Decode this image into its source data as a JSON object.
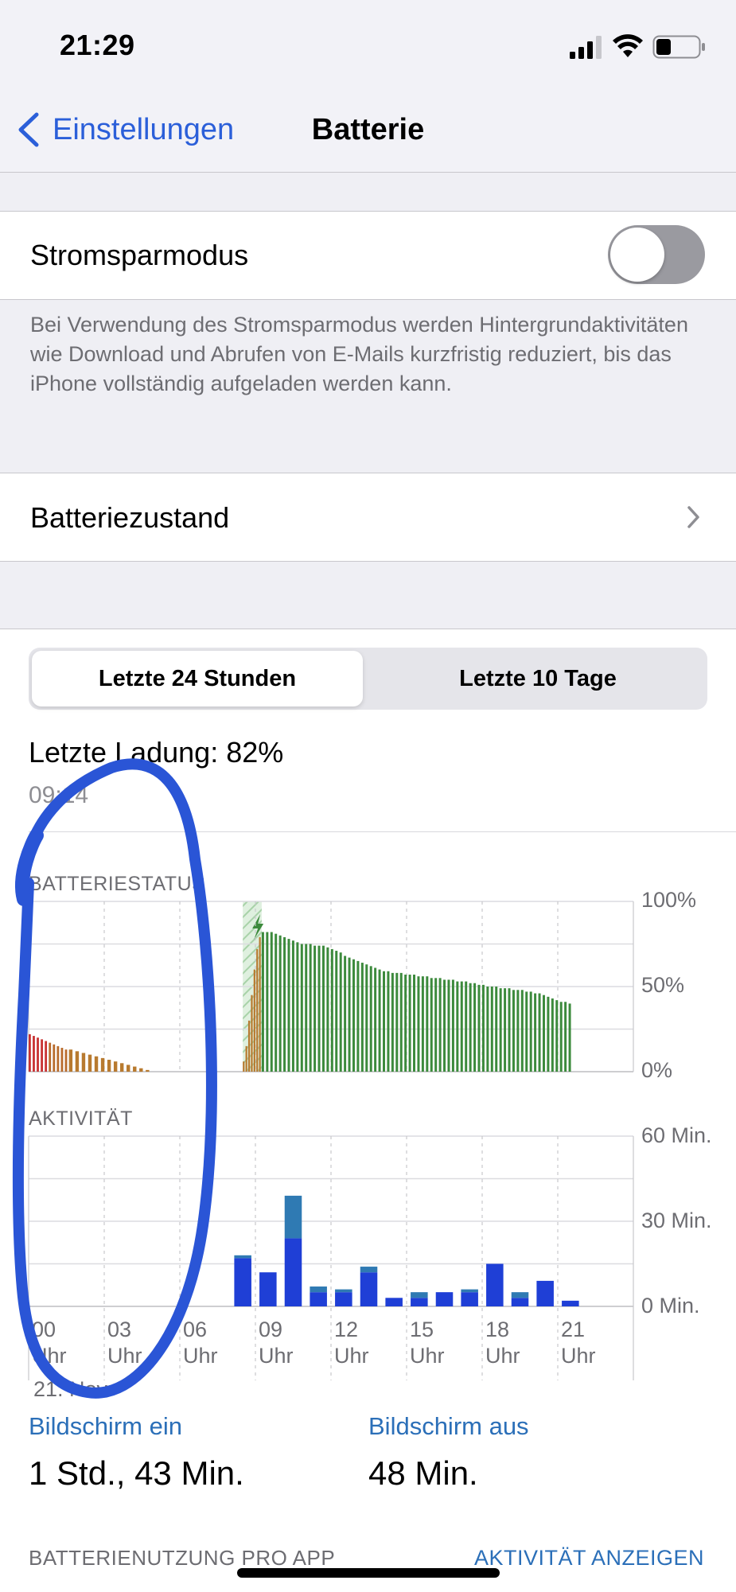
{
  "status": {
    "time": "21:29"
  },
  "nav": {
    "back_label": "Einstellungen",
    "title": "Batterie"
  },
  "low_power": {
    "label": "Stromsparmodus",
    "enabled": false,
    "description": "Bei Verwendung des Stromsparmodus werden Hintergrundaktivitäten wie Download und Abrufen von E-Mails kurzfristig reduziert, bis das iPhone vollständig aufgeladen werden kann."
  },
  "battery_health": {
    "label": "Batteriezustand"
  },
  "segment": {
    "options": [
      "Letzte 24 Stunden",
      "Letzte 10 Tage"
    ],
    "selected": 0
  },
  "last_charge": {
    "label": "Letzte Ladung: 82%",
    "time": "09:14"
  },
  "battery_chart": {
    "heading": "BATTERIESTATUS",
    "y_labels": [
      "100%",
      "50%",
      "0%"
    ]
  },
  "activity_chart": {
    "heading": "AKTIVITÄT",
    "y_labels": [
      "60 Min.",
      "30 Min.",
      "0 Min."
    ],
    "x_ticks": [
      {
        "hour": "00",
        "unit": "Uhr"
      },
      {
        "hour": "03",
        "unit": "Uhr"
      },
      {
        "hour": "06",
        "unit": "Uhr"
      },
      {
        "hour": "09",
        "unit": "Uhr"
      },
      {
        "hour": "12",
        "unit": "Uhr"
      },
      {
        "hour": "15",
        "unit": "Uhr"
      },
      {
        "hour": "18",
        "unit": "Uhr"
      },
      {
        "hour": "21",
        "unit": "Uhr"
      }
    ],
    "date_label": "21. Nov."
  },
  "chart_data": [
    {
      "type": "bar",
      "title": "BATTERIESTATUS",
      "ylabel": "",
      "ylim": [
        0,
        100
      ],
      "x_unit": "hour",
      "charging_window": [
        8.5,
        9.25
      ],
      "segments": [
        {
          "start_hour": 0.0,
          "end_hour": 1.6,
          "values": [
            22,
            21,
            20,
            19,
            18,
            17,
            16,
            15,
            14,
            13
          ],
          "colors": [
            "#c83232",
            "#c83232",
            "#c83232",
            "#c83232",
            "#c83232",
            "#b86a2a",
            "#b86a2a",
            "#b86a2a",
            "#b86a2a",
            "#b86a2a"
          ]
        },
        {
          "start_hour": 1.6,
          "end_hour": 4.9,
          "values": [
            13,
            12,
            11,
            10,
            9,
            8,
            7,
            6,
            5,
            4,
            3,
            2,
            1
          ],
          "color": "#b87a2f"
        },
        {
          "start_hour": 8.5,
          "end_hour": 9.25,
          "values": [
            6,
            15,
            30,
            45,
            60,
            72,
            79
          ],
          "color": "#b87a2f",
          "charging": true
        },
        {
          "start_hour": 9.25,
          "end_hour": 21.6,
          "values": [
            82,
            82,
            82,
            81,
            80,
            79,
            78,
            77,
            76,
            75,
            75,
            75,
            74,
            74,
            74,
            73,
            72,
            71,
            70,
            68,
            67,
            66,
            65,
            64,
            63,
            62,
            61,
            60,
            59,
            59,
            58,
            58,
            58,
            57,
            57,
            57,
            56,
            56,
            56,
            55,
            55,
            55,
            54,
            54,
            54,
            53,
            53,
            53,
            52,
            52,
            51,
            51,
            50,
            50,
            50,
            49,
            49,
            49,
            48,
            48,
            48,
            47,
            47,
            46,
            46,
            45,
            44,
            43,
            42,
            41,
            41,
            40
          ],
          "color": "#3c8a3c"
        }
      ]
    },
    {
      "type": "bar",
      "title": "AKTIVITÄT",
      "ylabel": "",
      "ylim": [
        0,
        60
      ],
      "categories": [
        "00",
        "03",
        "06",
        "09",
        "12",
        "15",
        "18",
        "21"
      ],
      "bin_hours": 1,
      "series": [
        {
          "name": "Bildschirm ein",
          "color": "#1f3fd6",
          "bars": [
            {
              "hour": 8,
              "value": 17
            },
            {
              "hour": 9,
              "value": 12
            },
            {
              "hour": 10,
              "value": 24
            },
            {
              "hour": 11,
              "value": 5
            },
            {
              "hour": 12,
              "value": 5
            },
            {
              "hour": 13,
              "value": 12
            },
            {
              "hour": 14,
              "value": 3
            },
            {
              "hour": 15,
              "value": 3
            },
            {
              "hour": 16,
              "value": 5
            },
            {
              "hour": 17,
              "value": 5
            },
            {
              "hour": 18,
              "value": 15
            },
            {
              "hour": 19,
              "value": 3
            },
            {
              "hour": 20,
              "value": 9
            },
            {
              "hour": 21,
              "value": 2
            }
          ]
        },
        {
          "name": "Bildschirm aus",
          "color": "#2f7ab3",
          "bars": [
            {
              "hour": 8,
              "value": 1
            },
            {
              "hour": 9,
              "value": 0
            },
            {
              "hour": 10,
              "value": 15
            },
            {
              "hour": 11,
              "value": 2
            },
            {
              "hour": 12,
              "value": 1
            },
            {
              "hour": 13,
              "value": 2
            },
            {
              "hour": 14,
              "value": 0
            },
            {
              "hour": 15,
              "value": 2
            },
            {
              "hour": 16,
              "value": 0
            },
            {
              "hour": 17,
              "value": 1
            },
            {
              "hour": 18,
              "value": 0
            },
            {
              "hour": 19,
              "value": 2
            },
            {
              "hour": 20,
              "value": 0
            },
            {
              "hour": 21,
              "value": 0
            }
          ]
        }
      ]
    }
  ],
  "screen_on": {
    "label": "Bildschirm ein",
    "value": "1 Std., 43 Min."
  },
  "screen_off": {
    "label": "Bildschirm aus",
    "value": "48 Min."
  },
  "usage": {
    "heading": "BATTERIENUTZUNG PRO APP",
    "link": "AKTIVITÄT ANZEIGEN"
  },
  "colors": {
    "accent": "#2b5fd9",
    "link": "#2b6fb8",
    "battery_green": "#3c8a3c",
    "battery_orange": "#b87a2f",
    "battery_red": "#c83232",
    "activity_on": "#1f3fd6",
    "activity_off": "#2f7ab3",
    "annotation": "#2a55d6"
  }
}
